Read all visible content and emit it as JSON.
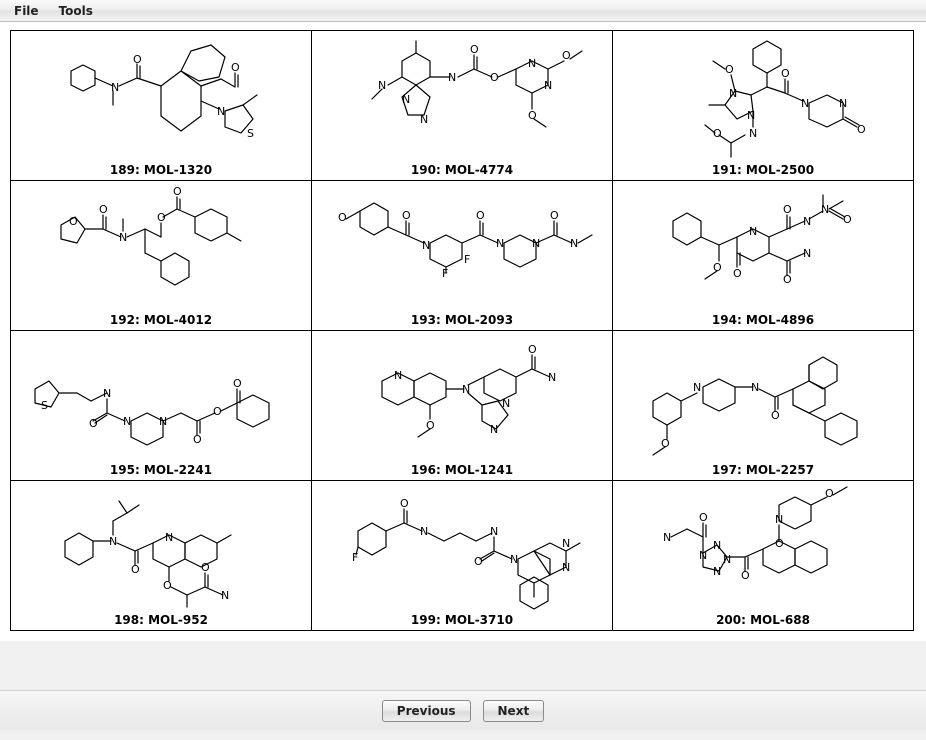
{
  "menu": {
    "file": "File",
    "tools": "Tools"
  },
  "molecules": [
    {
      "index": 189,
      "id": "MOL-1320",
      "caption": "189: MOL-1320"
    },
    {
      "index": 190,
      "id": "MOL-4774",
      "caption": "190: MOL-4774"
    },
    {
      "index": 191,
      "id": "MOL-2500",
      "caption": "191: MOL-2500"
    },
    {
      "index": 192,
      "id": "MOL-4012",
      "caption": "192: MOL-4012"
    },
    {
      "index": 193,
      "id": "MOL-2093",
      "caption": "193: MOL-2093"
    },
    {
      "index": 194,
      "id": "MOL-4896",
      "caption": "194: MOL-4896"
    },
    {
      "index": 195,
      "id": "MOL-2241",
      "caption": "195: MOL-2241"
    },
    {
      "index": 196,
      "id": "MOL-1241",
      "caption": "196: MOL-1241"
    },
    {
      "index": 197,
      "id": "MOL-2257",
      "caption": "197: MOL-2257"
    },
    {
      "index": 198,
      "id": "MOL-952",
      "caption": "198: MOL-952"
    },
    {
      "index": 199,
      "id": "MOL-3710",
      "caption": "199: MOL-3710"
    },
    {
      "index": 200,
      "id": "MOL-688",
      "caption": "200: MOL-688"
    }
  ],
  "buttons": {
    "previous": "Previous",
    "next": "Next"
  }
}
